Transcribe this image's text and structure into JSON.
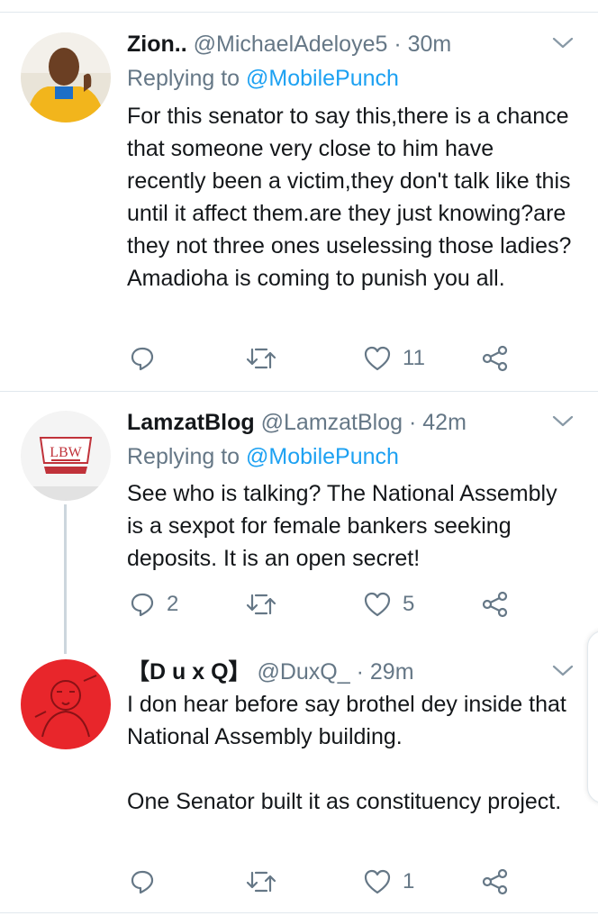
{
  "tweets": [
    {
      "name": "Zion..",
      "handle": "@MichaelAdeloye5",
      "time": "· 30m",
      "replying_label": "Replying to",
      "replying_to": "@MobilePunch",
      "text": "For this senator to say this,there is a chance that someone very close to him have recently been a victim,they don't talk like this until it affect them.are they just knowing?are they not three ones uselessing those ladies?Amadioha is coming to punish you all.",
      "replies": "",
      "retweets": "",
      "likes": "11"
    },
    {
      "name": "LamzatBlog",
      "handle": "@LamzatBlog",
      "time": "· 42m",
      "replying_label": "Replying to",
      "replying_to": "@MobilePunch",
      "avatar_logo_text": "LBW",
      "text": "See who is talking? The National Assembly is a sexpot for female bankers seeking deposits. It is an open secret!",
      "replies": "2",
      "retweets": "",
      "likes": "5"
    },
    {
      "name": "【D u x Q】",
      "handle": "@DuxQ_",
      "time": "· 29m",
      "text": "I don hear before say brothel dey inside that National Assembly building.\n\nOne Senator built it as constituency project.",
      "replies": "",
      "retweets": "",
      "likes": "1"
    }
  ],
  "icons": {
    "reply": "reply-icon",
    "retweet": "retweet-icon",
    "like": "heart-icon",
    "share": "share-icon",
    "caret": "chevron-down-icon"
  },
  "colors": {
    "text": "#14171a",
    "secondary": "#657786",
    "link": "#1da1f2",
    "divider": "#e1e8ed"
  }
}
